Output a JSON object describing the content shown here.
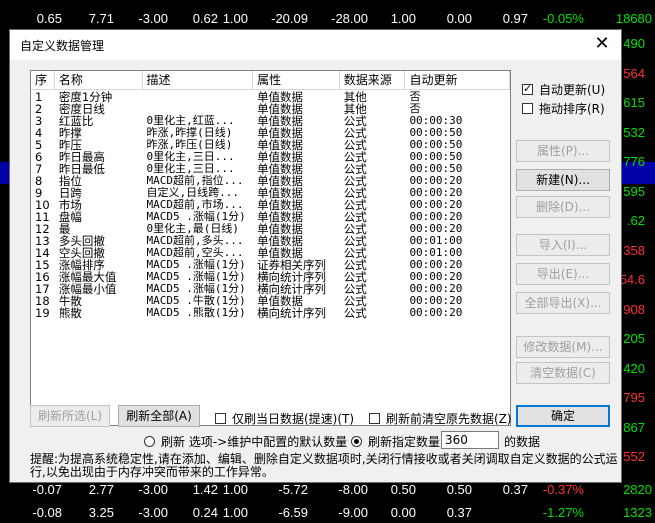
{
  "background": {
    "top_row": [
      "0.65",
      "7.71",
      "-3.00",
      "0.62",
      "1.00",
      "-20.09",
      "-28.00",
      "1.00",
      "0.00",
      "0.97",
      "-0.05%",
      "18680"
    ],
    "right_values": [
      {
        "text": "490",
        "color": "green"
      },
      {
        "text": "564",
        "color": "red"
      },
      {
        "text": "615",
        "color": "green"
      },
      {
        "text": "532",
        "color": "green"
      },
      {
        "text": "776",
        "color": "green"
      },
      {
        "text": "595",
        "color": "green"
      },
      {
        "text": ".62",
        "color": "green"
      },
      {
        "text": "358",
        "color": "red"
      },
      {
        "text": "54.6",
        "color": "red"
      },
      {
        "text": "908",
        "color": "red"
      },
      {
        "text": "205",
        "color": "green"
      },
      {
        "text": "420",
        "color": "green"
      },
      {
        "text": "795",
        "color": "red"
      },
      {
        "text": "867",
        "color": "green"
      },
      {
        "text": "552",
        "color": "red"
      }
    ],
    "row2": [
      "-0.07",
      "2.77",
      "-3.00",
      "1.42",
      "1.00",
      "-5.72",
      "-8.00",
      "0.50",
      "0.50",
      "0.37",
      "-0.37%",
      "2820"
    ],
    "bottom_row": [
      "-0.08",
      "3.25",
      "-3.00",
      "0.24",
      "1.00",
      "-6.59",
      "-9.00",
      "0.00",
      "0.37",
      "-1.27%",
      "1323"
    ]
  },
  "dialog": {
    "title": "自定义数据管理",
    "close_glyph": "✕",
    "columns": [
      "序",
      "名称",
      "描述",
      "属性",
      "数据来源",
      "自动更新"
    ],
    "rows": [
      [
        "1",
        "密度1分钟",
        "",
        "单值数据",
        "其他",
        "否"
      ],
      [
        "2",
        "密度日线",
        "",
        "单值数据",
        "其他",
        "否"
      ],
      [
        "3",
        "红蓝比",
        "0里化主,红蓝...",
        "单值数据",
        "公式",
        "00:00:30"
      ],
      [
        "4",
        "昨撑",
        "昨涨,昨撑(日线)",
        "单值数据",
        "公式",
        "00:00:50"
      ],
      [
        "5",
        "昨压",
        "昨涨,昨压(日线)",
        "单值数据",
        "公式",
        "00:00:50"
      ],
      [
        "6",
        "昨日最高",
        "0里化主,三日...",
        "单值数据",
        "公式",
        "00:00:50"
      ],
      [
        "7",
        "昨日最低",
        "0里化主,三日...",
        "单值数据",
        "公式",
        "00:00:50"
      ],
      [
        "8",
        "指位",
        "MACD超前,指位...",
        "单值数据",
        "公式",
        "00:00:20"
      ],
      [
        "9",
        "日跨",
        "自定义,日线跨...",
        "单值数据",
        "公式",
        "00:00:20"
      ],
      [
        "10",
        "市场",
        "MACD超前,市场...",
        "单值数据",
        "公式",
        "00:00:20"
      ],
      [
        "11",
        "盘幅",
        "MACD5 .涨幅(1分)",
        "单值数据",
        "公式",
        "00:00:20"
      ],
      [
        "12",
        "最",
        "0里化主,最(日线)",
        "单值数据",
        "公式",
        "00:00:20"
      ],
      [
        "13",
        "多头回撤",
        "MACD超前,多头...",
        "单值数据",
        "公式",
        "00:01:00"
      ],
      [
        "14",
        "空头回撤",
        "MACD超前,空头...",
        "单值数据",
        "公式",
        "00:01:00"
      ],
      [
        "15",
        "涨幅排序",
        "MACD5 .涨幅(1分)",
        "证券相关序列",
        "公式",
        "00:00:20"
      ],
      [
        "16",
        "涨幅最大值",
        "MACD5 .涨幅(1分)",
        "横向统计序列",
        "公式",
        "00:00:20"
      ],
      [
        "17",
        "涨幅最小值",
        "MACD5 .涨幅(1分)",
        "横向统计序列",
        "公式",
        "00:00:20"
      ],
      [
        "18",
        "牛散",
        "MACD5 .牛散(1分)",
        "单值数据",
        "公式",
        "00:00:20"
      ],
      [
        "19",
        "熊散",
        "MACD5 .熊散(1分)",
        "横向统计序列",
        "公式",
        "00:00:20"
      ]
    ],
    "auto_update_label": "自动更新(U)",
    "auto_update_checked": true,
    "drag_sort_label": "拖动排序(R)",
    "drag_sort_checked": false,
    "buttons": {
      "attr": "属性(P)...",
      "new": "新建(N)...",
      "delete": "删除(D)...",
      "import": "导入(I)...",
      "export": "导出(E)...",
      "export_all": "全部导出(X)...",
      "modify": "修改数据(M)...",
      "clear": "清空数据(C)",
      "refresh_selected": "刷新所选(L)",
      "refresh_all": "刷新全部(A)",
      "ok": "确定"
    },
    "only_today_label": "仅刷当日数据(提速)(T)",
    "clear_before_label": "刷新前清空原先数据(Z)",
    "radio_default_label": "刷新 选项->维护中配置的默认数量",
    "radio_custom_label": "刷新指定数量",
    "custom_count": "360",
    "custom_suffix": "的数据",
    "hint": "提醒:为提高系统稳定性,请在添加、编辑、删除自定义数据项时,关闭行情接收或者关闭调取自定义数据的公式运行,以免出现由于内存冲突而带来的工作异常。"
  }
}
